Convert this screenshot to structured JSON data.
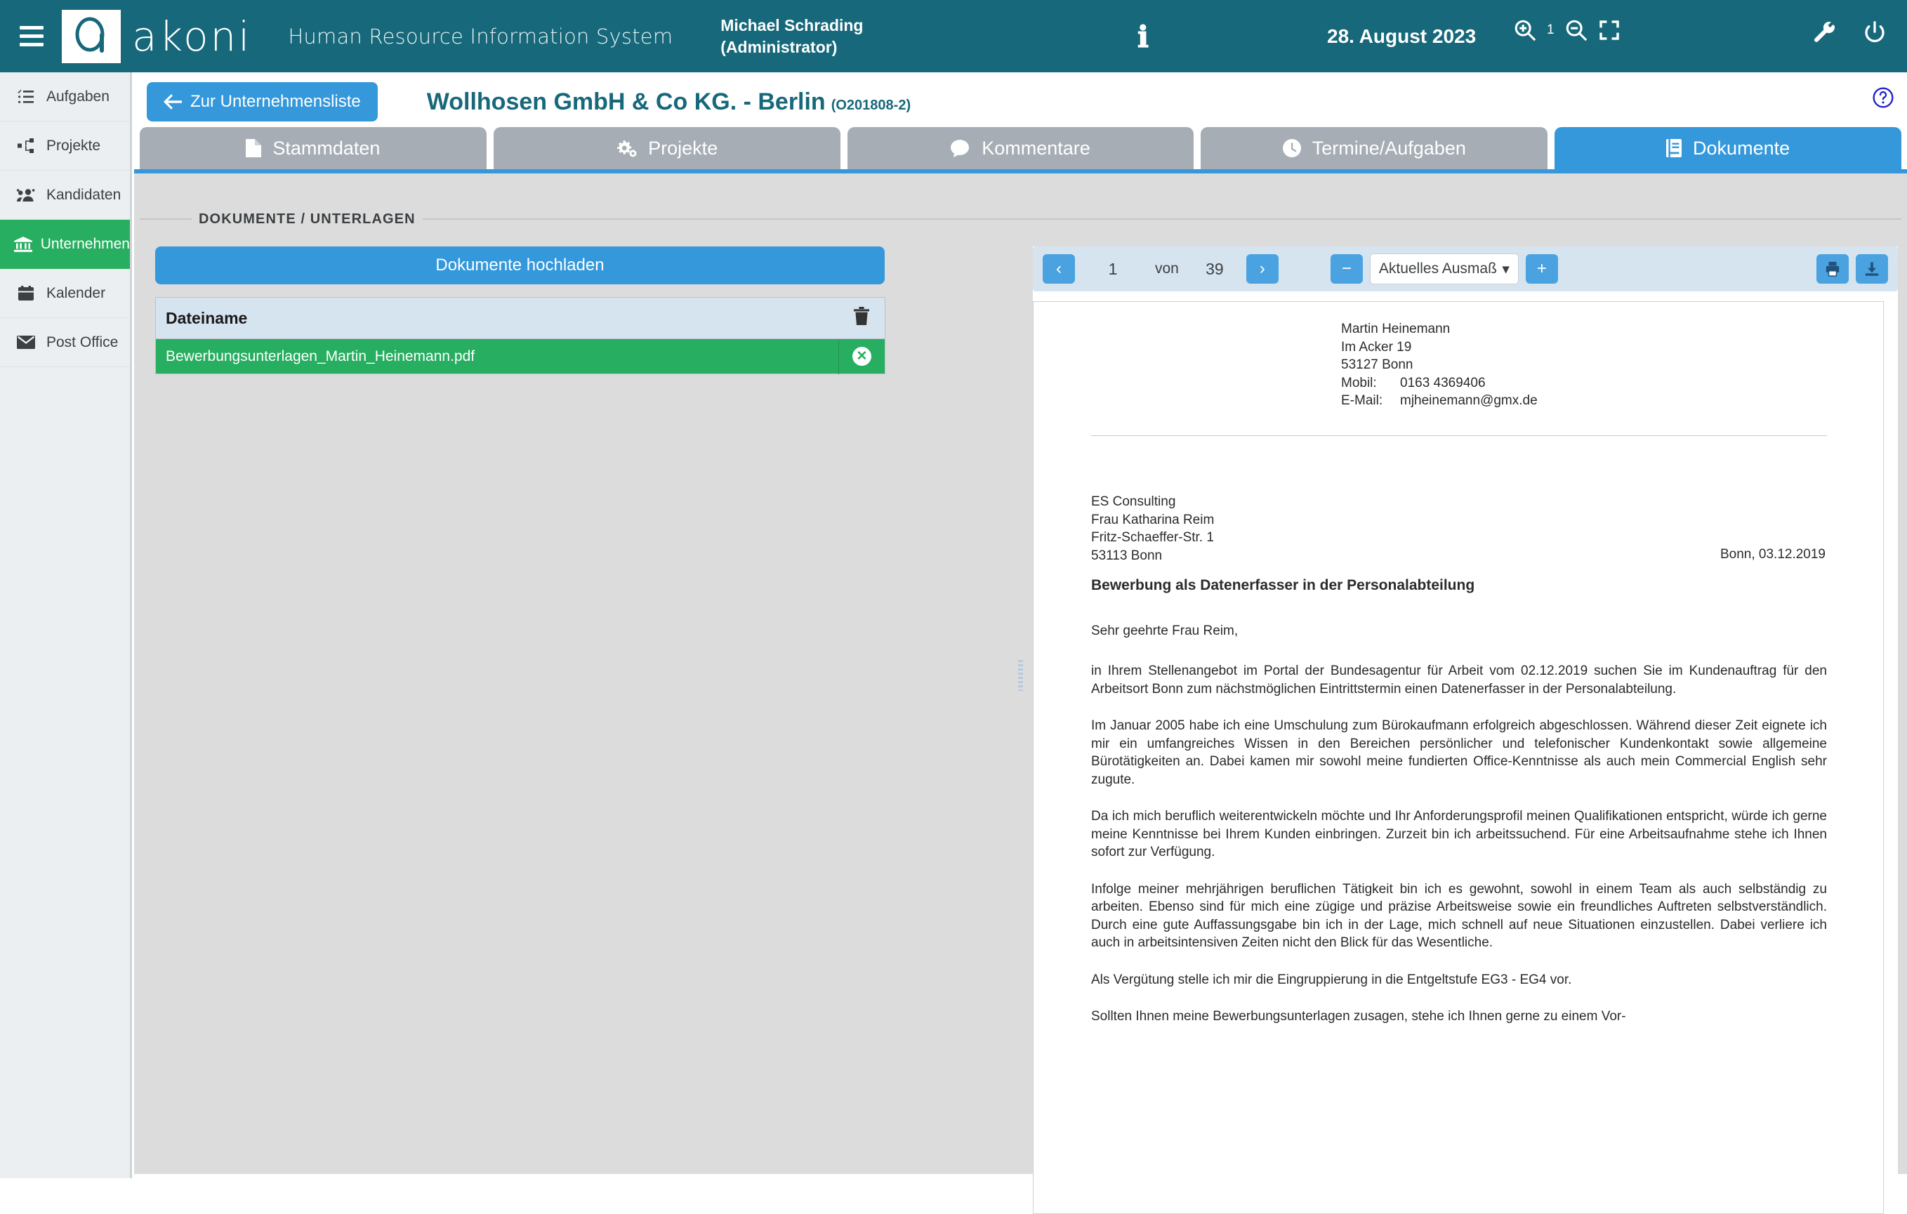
{
  "topbar": {
    "menu_icon": "hamburger-icon",
    "brand": "akoni",
    "subtitle": "Human Resource Information System",
    "user_name": "Michael Schrading",
    "user_role": "(Administrator)",
    "info_icon": "info-icon",
    "date": "28. August 2023",
    "zoom_in_icon": "zoom-in-icon",
    "zoom_level": "1",
    "zoom_out_icon": "zoom-out-icon",
    "fullscreen_icon": "fullscreen-icon",
    "settings_icon": "wrench-icon",
    "power_icon": "power-icon",
    "accent": "#16687a"
  },
  "sidebar": {
    "items": [
      {
        "label": "Aufgaben",
        "icon": "tasks-list-icon",
        "active": false
      },
      {
        "label": "Projekte",
        "icon": "sitemap-icon",
        "active": false
      },
      {
        "label": "Kandidaten",
        "icon": "users-icon",
        "active": false
      },
      {
        "label": "Unternehmen",
        "icon": "bank-icon",
        "active": true
      },
      {
        "label": "Kalender",
        "icon": "calendar-icon",
        "active": false
      },
      {
        "label": "Post Office",
        "icon": "envelope-icon",
        "active": false
      }
    ],
    "active_color": "#27ae60"
  },
  "subheader": {
    "back_label": "Zur Unternehmensliste",
    "back_icon": "arrow-left-icon",
    "company_name": "Wollhosen GmbH & Co KG. - Berlin",
    "company_id": "(O201808-2)",
    "help_icon": "question-circle-icon"
  },
  "tabs": [
    {
      "label": "Stammdaten",
      "icon": "file-icon",
      "active": false
    },
    {
      "label": "Projekte",
      "icon": "gears-icon",
      "active": false
    },
    {
      "label": "Kommentare",
      "icon": "comment-icon",
      "active": false
    },
    {
      "label": "Termine/Aufgaben",
      "icon": "clock-icon",
      "active": false
    },
    {
      "label": "Dokumente",
      "icon": "book-icon",
      "active": true
    }
  ],
  "documents_panel": {
    "section_label": "DOKUMENTE / UNTERLAGEN",
    "upload_button": "Dokumente hochladen",
    "table": {
      "columns": [
        "Dateiname",
        ""
      ],
      "trash_icon": "trash-icon",
      "rows": [
        {
          "filename": "Bewerbungsunterlagen_Martin_Heinemann.pdf",
          "remove_icon": "remove-circle-icon",
          "selected": true
        }
      ]
    }
  },
  "viewer": {
    "prev_icon": "chevron-left-icon",
    "next_icon": "chevron-right-icon",
    "page_current": "1",
    "of_label": "von",
    "page_total": "39",
    "zoom_out_label": "−",
    "zoom_select_value": "Aktuelles Ausmaß",
    "zoom_select_caret": "chevron-down-icon",
    "zoom_in_label": "+",
    "print_icon": "print-icon",
    "download_icon": "download-icon"
  },
  "pdf": {
    "sender": {
      "name": "Martin Heinemann",
      "street": "Im Acker 19",
      "city": "53127 Bonn",
      "mobile_label": "Mobil:",
      "mobile_value": "0163 4369406",
      "email_label": "E-Mail:",
      "email_value": "mjheinemann@gmx.de"
    },
    "recipient": {
      "company": "ES Consulting",
      "person": "Frau Katharina Reim",
      "street": "Fritz-Schaeffer-Str. 1",
      "city": "53113 Bonn"
    },
    "dateline": "Bonn, 03.12.2019",
    "subject": "Bewerbung als Datenerfasser in der Personalabteilung",
    "salutation": "Sehr geehrte Frau Reim,",
    "paragraphs": [
      "in Ihrem Stellenangebot im Portal der Bundesagentur für Arbeit vom 02.12.2019 suchen Sie im Kundenauftrag für den Arbeitsort Bonn zum nächstmöglichen Eintrittstermin einen Datenerfasser in der Personalabteilung.",
      "Im Januar 2005 habe ich eine Umschulung zum Bürokaufmann erfolgreich abgeschlossen. Während dieser Zeit eignete ich mir ein umfangreiches Wissen in den Bereichen persönlicher und telefonischer Kundenkontakt sowie allgemeine Bürotätigkeiten an. Dabei kamen mir sowohl meine fundierten Office-Kenntnisse als auch mein Commercial English sehr zugute.",
      "Da ich mich beruflich weiterentwickeln möchte und Ihr Anforderungsprofil meinen Qualifikationen entspricht, würde ich gerne meine Kenntnisse bei Ihrem Kunden einbringen. Zurzeit bin ich arbeitssuchend. Für eine Arbeitsaufnahme stehe ich Ihnen sofort zur Verfügung.",
      "Infolge meiner mehrjährigen beruflichen Tätigkeit bin ich es gewohnt, sowohl in einem Team als auch selbständig zu arbeiten. Ebenso sind für mich eine zügige und präzise Arbeitsweise sowie ein freundliches Auftreten selbstverständlich. Durch eine gute Auffassungsgabe bin ich in der Lage, mich schnell auf neue Situationen einzustellen. Dabei verliere ich auch in arbeitsintensiven Zeiten nicht den Blick für das Wesentliche.",
      "Als Vergütung stelle ich mir die Eingruppierung in die Entgeltstufe EG3 - EG4 vor.",
      "Sollten Ihnen meine Bewerbungsunterlagen zusagen, stehe ich Ihnen gerne zu einem Vor-"
    ]
  }
}
